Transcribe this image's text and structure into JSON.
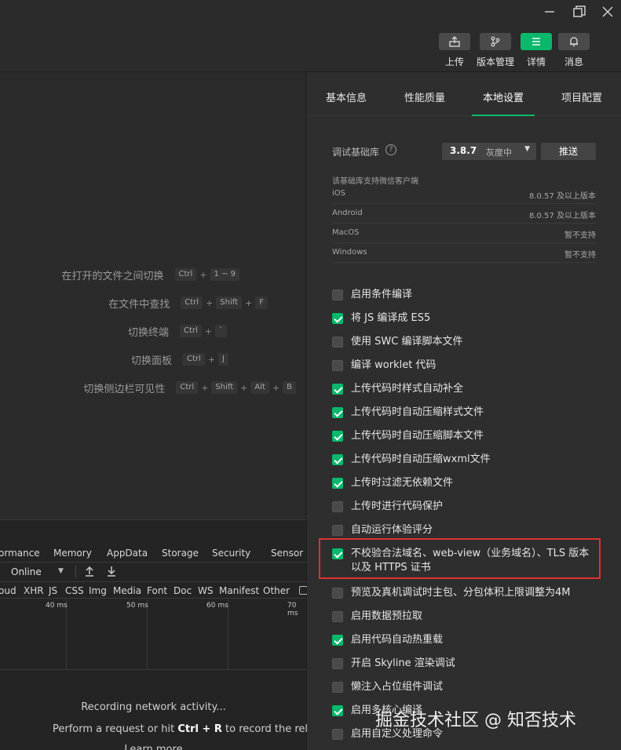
{
  "toolbar": {
    "upload": "上传",
    "version": "版本管理",
    "details": "详情",
    "messages": "消息"
  },
  "shortcuts": [
    {
      "label": "在打开的文件之间切换",
      "keys": [
        "Ctrl",
        "1 ~ 9"
      ]
    },
    {
      "label": "在文件中查找",
      "keys": [
        "Ctrl",
        "Shift",
        "F"
      ]
    },
    {
      "label": "切换终端",
      "keys": [
        "Ctrl",
        "`"
      ]
    },
    {
      "label": "切换面板",
      "keys": [
        "Ctrl",
        "J"
      ]
    },
    {
      "label": "切换侧边栏可见性",
      "keys": [
        "Ctrl",
        "Shift",
        "Alt",
        "B"
      ]
    }
  ],
  "devtools": {
    "tabs": [
      "ormance",
      "Memory",
      "AppData",
      "Storage",
      "Security",
      "Sensor"
    ],
    "throttle": "Online",
    "filters": [
      "oud",
      "XHR",
      "JS",
      "CSS",
      "Img",
      "Media",
      "Font",
      "Doc",
      "WS",
      "Manifest",
      "Other"
    ],
    "ticks": [
      "40 ms",
      "50 ms",
      "60 ms",
      "70 ms"
    ],
    "recording": "Recording network activity...",
    "perform_pre": "Perform a request or hit ",
    "perform_key": "Ctrl + R",
    "perform_post": " to record the reload",
    "learn": "Learn more"
  },
  "panel": {
    "tabs": [
      "基本信息",
      "性能质量",
      "本地设置",
      "项目配置"
    ],
    "active_tab": "本地设置",
    "lib_label": "调试基础库",
    "lib_version": "3.8.7",
    "lib_channel": "灰度中",
    "push": "推送",
    "support_note": "该基础库支持微信客户端",
    "platforms": [
      {
        "name": "iOS",
        "value": "8.0.57 及以上版本"
      },
      {
        "name": "Android",
        "value": "8.0.57 及以上版本"
      },
      {
        "name": "MacOS",
        "value": "暂不支持"
      },
      {
        "name": "Windows",
        "value": "暂不支持"
      }
    ],
    "options": [
      {
        "label": "启用条件编译",
        "checked": false
      },
      {
        "label": "将 JS 编译成 ES5",
        "checked": true
      },
      {
        "label": "使用 SWC 编译脚本文件",
        "checked": false
      },
      {
        "label": "编译 worklet 代码",
        "checked": false
      },
      {
        "label": "上传代码时样式自动补全",
        "checked": true
      },
      {
        "label": "上传代码时自动压缩样式文件",
        "checked": true
      },
      {
        "label": "上传代码时自动压缩脚本文件",
        "checked": true
      },
      {
        "label": "上传代码时自动压缩wxml文件",
        "checked": true
      },
      {
        "label": "上传时过滤无依赖文件",
        "checked": true
      },
      {
        "label": "上传时进行代码保护",
        "checked": false
      },
      {
        "label": "自动运行体验评分",
        "checked": false
      },
      {
        "label": "不校验合法域名、web-view（业务域名）、TLS 版本以及 HTTPS 证书",
        "checked": true
      },
      {
        "label": "预览及真机调试时主包、分包体积上限调整为4M",
        "checked": false
      },
      {
        "label": "启用数据预拉取",
        "checked": false
      },
      {
        "label": "启用代码自动热重载",
        "checked": true
      },
      {
        "label": "开启 Skyline 渲染调试",
        "checked": false
      },
      {
        "label": "懒注入占位组件调试",
        "checked": false
      },
      {
        "label": "启用多核心编译",
        "checked": true
      },
      {
        "label": "启用自定义处理命令",
        "checked": false
      }
    ]
  },
  "watermark": "掘金技术社区 @ 知否技术"
}
